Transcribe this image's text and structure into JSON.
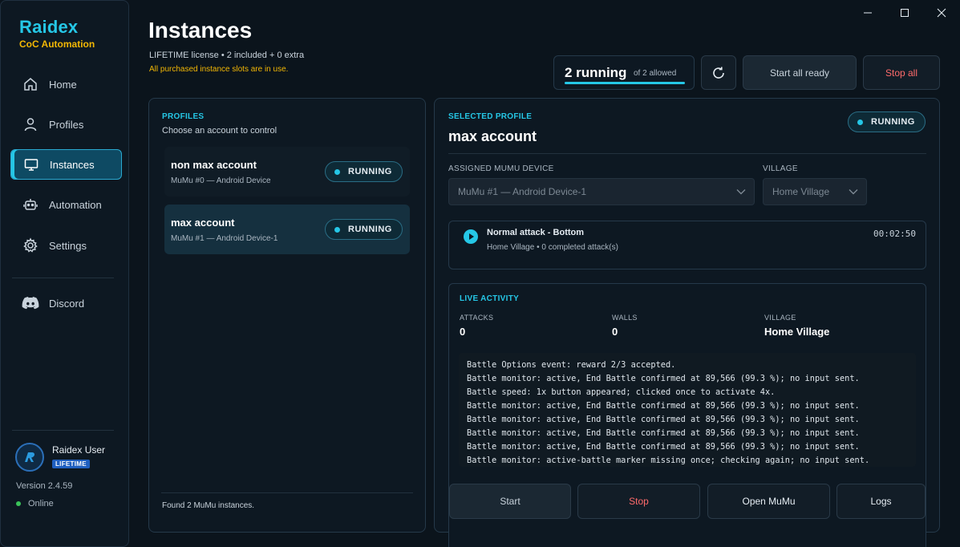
{
  "brand": {
    "name": "Raidex",
    "subtitle": "CoC Automation"
  },
  "nav": {
    "home": "Home",
    "profiles": "Profiles",
    "instances": "Instances",
    "automation": "Automation",
    "settings": "Settings",
    "discord": "Discord"
  },
  "user": {
    "name": "Raidex User",
    "badge": "LIFETIME",
    "version": "Version 2.4.59",
    "status": "Online"
  },
  "header": {
    "title": "Instances",
    "license": "LIFETIME license • 2 included + 0 extra",
    "warning": "All purchased instance slots are in use."
  },
  "running": {
    "count_label": "2 running",
    "of_label": "of 2 allowed",
    "fraction": 1.0
  },
  "toolbar": {
    "start_all": "Start all ready",
    "stop_all": "Stop all"
  },
  "profiles_panel": {
    "section": "PROFILES",
    "subtitle": "Choose an account to control",
    "items": [
      {
        "name": "non max account",
        "device": "MuMu #0 — Android Device",
        "status": "RUNNING"
      },
      {
        "name": "max account",
        "device": "MuMu #1 — Android Device-1",
        "status": "RUNNING"
      }
    ],
    "footer": "Found 2 MuMu instances."
  },
  "selected": {
    "section": "SELECTED PROFILE",
    "name": "max account",
    "status": "RUNNING",
    "device_label": "ASSIGNED MUMU DEVICE",
    "device_value": "MuMu #1 — Android Device-1",
    "village_label": "VILLAGE",
    "village_value": "Home Village",
    "task": {
      "name": "Normal attack - Bottom",
      "sub": "Home Village • 0 completed attack(s)",
      "timer": "00:02:50"
    }
  },
  "live": {
    "section": "LIVE ACTIVITY",
    "attacks_label": "ATTACKS",
    "attacks_value": "0",
    "walls_label": "WALLS",
    "walls_value": "0",
    "village_label": "VILLAGE",
    "village_value": "Home Village",
    "log": [
      "Battle Options event: reward 2/3 accepted.",
      "Battle monitor: active, End Battle confirmed at 89,566 (99.3 %); no input sent.",
      "Battle speed: 1x button appeared; clicked once to activate 4x.",
      "Battle monitor: active, End Battle confirmed at 89,566 (99.3 %); no input sent.",
      "Battle monitor: active, End Battle confirmed at 89,566 (99.3 %); no input sent.",
      "Battle monitor: active, End Battle confirmed at 89,566 (99.3 %); no input sent.",
      "Battle monitor: active, End Battle confirmed at 89,566 (99.3 %); no input sent.",
      "Battle monitor: active-battle marker missing once; checking again; no input sent."
    ]
  },
  "actions": {
    "start": "Start",
    "stop": "Stop",
    "open_mumu": "Open MuMu",
    "logs": "Logs"
  },
  "colors": {
    "accent": "#25c7e6",
    "brand_yellow": "#f2b705",
    "danger": "#ff6b6b",
    "online": "#3ac35a"
  }
}
